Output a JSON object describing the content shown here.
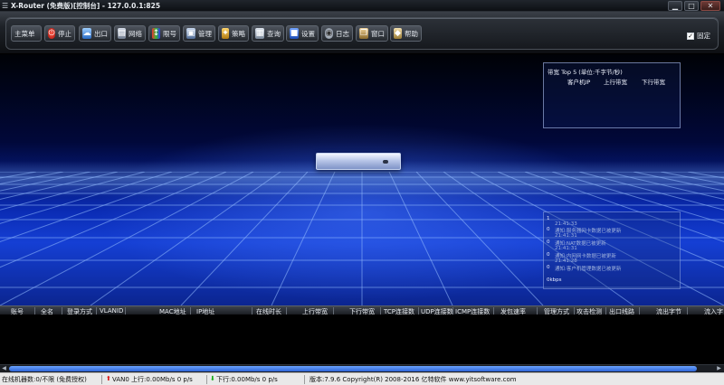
{
  "window": {
    "title": "X-Router (免费版)[控制台] - 127.0.0.1:825",
    "min_glyph": "▁",
    "max_glyph": "□",
    "close_glyph": "✕"
  },
  "toolbar": {
    "buttons": [
      {
        "label": "主菜单",
        "icon": "menu-icon"
      },
      {
        "label": "停止",
        "icon": "stop-icon"
      },
      {
        "label": "出口",
        "icon": "exit-icon"
      },
      {
        "label": "网络",
        "icon": "network-icon"
      },
      {
        "label": "限号",
        "icon": "limit-icon"
      },
      {
        "label": "管理",
        "icon": "manage-icon"
      },
      {
        "label": "策略",
        "icon": "policy-icon"
      },
      {
        "label": "查询",
        "icon": "query-icon"
      },
      {
        "label": "设置",
        "icon": "settings-icon"
      },
      {
        "label": "日志",
        "icon": "log-icon"
      },
      {
        "label": "窗口",
        "icon": "window-icon"
      },
      {
        "label": "帮助",
        "icon": "help-icon"
      }
    ],
    "pin_label": "固定",
    "pin_checked": "✓"
  },
  "bandwidth": {
    "title": "带宽 Top 5 (单位:千字节/秒)",
    "col_client": "客户机IP",
    "col_up": "上行带宽",
    "col_down": "下行带宽"
  },
  "log": {
    "lines": [
      {
        "text": "1",
        "kind": "num"
      },
      {
        "text": "21:41:33",
        "kind": "time"
      },
      {
        "text": "0",
        "kind": "num"
      },
      {
        "text": "通知:服务器网卡数据已被更新",
        "kind": "msg"
      },
      {
        "text": "21:41:31",
        "kind": "time"
      },
      {
        "text": "0",
        "kind": "num"
      },
      {
        "text": "通知:NAT数据已被更新",
        "kind": "msg"
      },
      {
        "text": "21:41:31",
        "kind": "time"
      },
      {
        "text": "0",
        "kind": "num"
      },
      {
        "text": "通知:内网网卡数据已被更新",
        "kind": "msg"
      },
      {
        "text": "21:41:28",
        "kind": "time"
      },
      {
        "text": "0",
        "kind": "num"
      },
      {
        "text": "通知:客户机管理数据已被更新",
        "kind": "msg"
      },
      {
        "text": "0kbps",
        "kind": "num"
      }
    ]
  },
  "table": {
    "headers": [
      "账号",
      "全名",
      "登录方式",
      "VLANID",
      "MAC地址",
      "IP地址",
      "在线时长",
      "上行带宽",
      "下行带宽",
      "TCP连接数",
      "UDP连接数",
      "ICMP连接数",
      "发包速率",
      "管理方式",
      "攻击检测",
      "出口线路",
      "流出字节",
      "流入字"
    ]
  },
  "status": {
    "online": "在线机器数:0/不限 (免费授权)",
    "up": "VAN0 上行:0.00Mb/s 0 p/s",
    "down": "下行:0.00Mb/s 0 p/s",
    "version": "版本:7.9.6 Copyright(R) 2008-2016 亿特软件 www.yitsoftware.com"
  }
}
